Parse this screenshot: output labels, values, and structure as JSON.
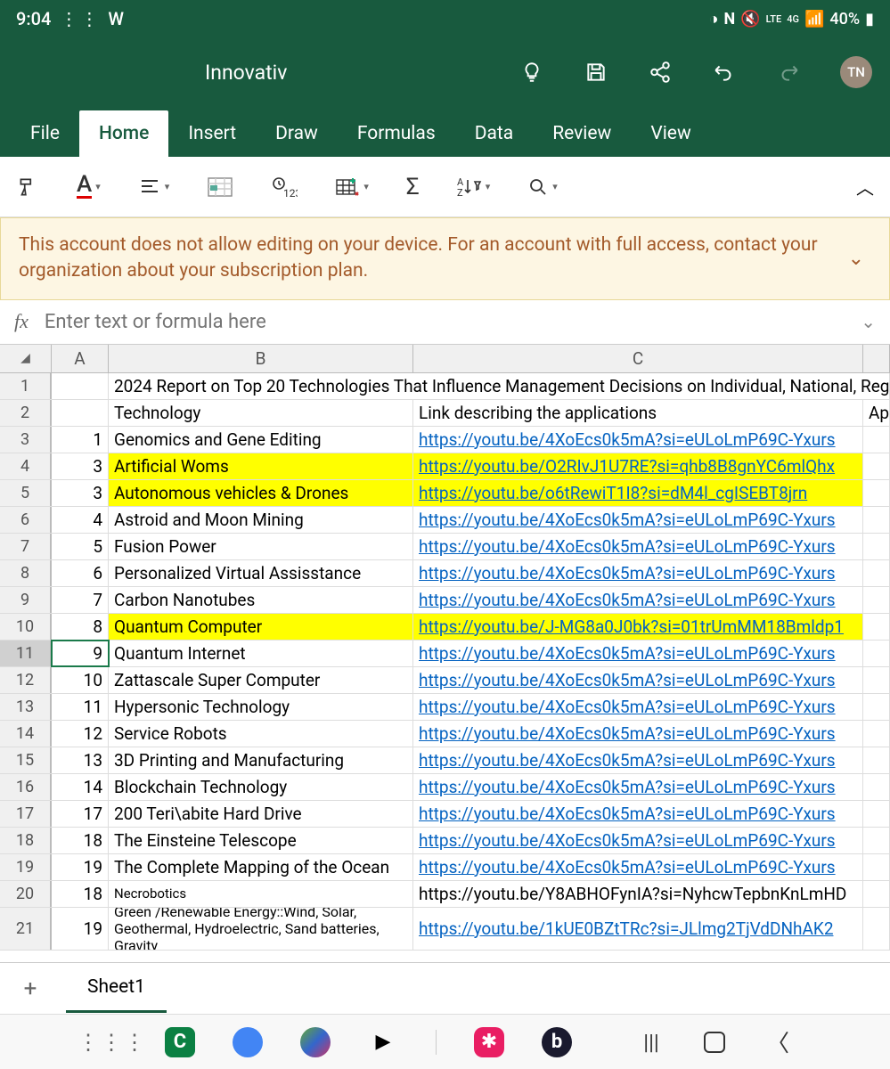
{
  "status": {
    "time": "9:04",
    "battery": "40%",
    "network": "4G",
    "lte": "LTE"
  },
  "document": {
    "title": "Innovativ",
    "avatar": "TN"
  },
  "menu": {
    "items": [
      "File",
      "Home",
      "Insert",
      "Draw",
      "Formulas",
      "Data",
      "Review",
      "View"
    ],
    "active": 1
  },
  "warning": "This account does not allow editing on your device. For an account with full access, contact your organization about your subscription plan.",
  "formula": {
    "label": "fx",
    "placeholder": "Enter text or formula here"
  },
  "columns": [
    "A",
    "B",
    "C"
  ],
  "rows": [
    {
      "n": 1,
      "a": "",
      "b": "2024 Report on Top 20 Technologies That Influence Management Decisions on Individual, National, Reg",
      "c": "",
      "spill": true
    },
    {
      "n": 2,
      "a": "",
      "b": "Technology",
      "c": "Link describing the applications",
      "d": "App"
    },
    {
      "n": 3,
      "a": "1",
      "b": "Genomics  and Gene Editing",
      "c": "https://youtu.be/4XoEcs0k5mA?si=eULoLmP69C-Yxurs",
      "link": true
    },
    {
      "n": 4,
      "a": "3",
      "b": "Artificial Woms",
      "c": "https://youtu.be/O2RIvJ1U7RE?si=qhb8B8gnYC6mlQhx",
      "link": true,
      "hl": true
    },
    {
      "n": 5,
      "a": "3",
      "b": "Autonomous vehicles & Drones",
      "c": "https://youtu.be/o6tRewiT1I8?si=dM4l_cgISEBT8jrn",
      "link": true,
      "hl": true
    },
    {
      "n": 6,
      "a": "4",
      "b": "Astroid and Moon Mining",
      "c": "https://youtu.be/4XoEcs0k5mA?si=eULoLmP69C-Yxurs",
      "link": true
    },
    {
      "n": 7,
      "a": "5",
      "b": "Fusion Power",
      "c": "https://youtu.be/4XoEcs0k5mA?si=eULoLmP69C-Yxurs",
      "link": true
    },
    {
      "n": 8,
      "a": "6",
      "b": "Personalized Virtual Assisstance",
      "c": "https://youtu.be/4XoEcs0k5mA?si=eULoLmP69C-Yxurs",
      "link": true
    },
    {
      "n": 9,
      "a": "7",
      "b": "Carbon Nanotubes",
      "c": "https://youtu.be/4XoEcs0k5mA?si=eULoLmP69C-Yxurs",
      "link": true
    },
    {
      "n": 10,
      "a": "8",
      "b": "Quantum Computer",
      "c": "https://youtu.be/J-MG8a0J0bk?si=01trUmMM18Bmldp1",
      "link": true,
      "hl": true
    },
    {
      "n": 11,
      "a": "9",
      "b": "Quantum Internet",
      "c": "https://youtu.be/4XoEcs0k5mA?si=eULoLmP69C-Yxurs",
      "link": true,
      "selected": true
    },
    {
      "n": 12,
      "a": "10",
      "b": "Zattascale Super Computer",
      "c": "https://youtu.be/4XoEcs0k5mA?si=eULoLmP69C-Yxurs",
      "link": true
    },
    {
      "n": 13,
      "a": "11",
      "b": "Hypersonic Technology",
      "c": "https://youtu.be/4XoEcs0k5mA?si=eULoLmP69C-Yxurs",
      "link": true
    },
    {
      "n": 14,
      "a": "12",
      "b": "Service Robots",
      "c": "https://youtu.be/4XoEcs0k5mA?si=eULoLmP69C-Yxurs",
      "link": true
    },
    {
      "n": 15,
      "a": "13",
      "b": "3D Printing and Manufacturing",
      "c": "https://youtu.be/4XoEcs0k5mA?si=eULoLmP69C-Yxurs",
      "link": true
    },
    {
      "n": 16,
      "a": "14",
      "b": "Blockchain Technology",
      "c": "https://youtu.be/4XoEcs0k5mA?si=eULoLmP69C-Yxurs",
      "link": true
    },
    {
      "n": 17,
      "a": "17",
      "b": "200 Teri\\abite Hard Drive",
      "c": "https://youtu.be/4XoEcs0k5mA?si=eULoLmP69C-Yxurs",
      "link": true
    },
    {
      "n": 18,
      "a": "18",
      "b": "The Einsteine Telescope",
      "c": "https://youtu.be/4XoEcs0k5mA?si=eULoLmP69C-Yxurs",
      "link": true
    },
    {
      "n": 19,
      "a": "19",
      "b": "The Complete Mapping of the Ocean",
      "c": "https://youtu.be/4XoEcs0k5mA?si=eULoLmP69C-Yxurs",
      "link": true
    },
    {
      "n": 20,
      "a": "18",
      "b": "Necrobotics",
      "c": "https://youtu.be/Y8ABHOFynIA?si=NyhcwTepbnKnLmHD",
      "small": true
    },
    {
      "n": 21,
      "a": "19",
      "b": "Green /Renewable Energy::Wind, Solar, Geothermal, Hydroelectric, Sand batteries, Gravity",
      "c": "https://youtu.be/1kUE0BZtTRc?si=JLlmg2TjVdDNhAK2",
      "link": true,
      "tall": true,
      "wrap": true
    }
  ],
  "sheets": {
    "active": "Sheet1"
  }
}
